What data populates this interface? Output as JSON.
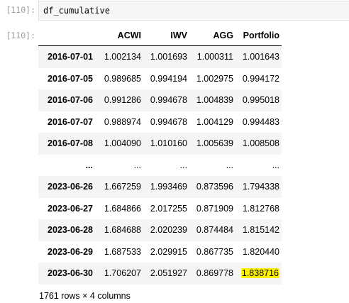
{
  "input_cell": {
    "prompt": "[110]:",
    "code": "df_cumulative"
  },
  "output_cell": {
    "prompt": "[110]:"
  },
  "dataframe": {
    "index_header": "",
    "columns": [
      "ACWI",
      "IWV",
      "AGG",
      "Portfolio"
    ],
    "rows": [
      {
        "index": "2016-07-01",
        "values": [
          "1.002134",
          "1.001693",
          "1.000311",
          "1.001643"
        ]
      },
      {
        "index": "2016-07-05",
        "values": [
          "0.989685",
          "0.994194",
          "1.002975",
          "0.994172"
        ]
      },
      {
        "index": "2016-07-06",
        "values": [
          "0.991286",
          "0.994678",
          "1.004839",
          "0.995018"
        ]
      },
      {
        "index": "2016-07-07",
        "values": [
          "0.988974",
          "0.994678",
          "1.004129",
          "0.994483"
        ]
      },
      {
        "index": "2016-07-08",
        "values": [
          "1.004090",
          "1.010160",
          "1.005639",
          "1.008508"
        ]
      },
      {
        "index": "...",
        "values": [
          "...",
          "...",
          "...",
          "..."
        ]
      },
      {
        "index": "2023-06-26",
        "values": [
          "1.667259",
          "1.993469",
          "0.873596",
          "1.794338"
        ]
      },
      {
        "index": "2023-06-27",
        "values": [
          "1.684866",
          "2.017255",
          "0.871909",
          "1.812768"
        ]
      },
      {
        "index": "2023-06-28",
        "values": [
          "1.684688",
          "2.020239",
          "0.874484",
          "1.815142"
        ]
      },
      {
        "index": "2023-06-29",
        "values": [
          "1.687533",
          "2.029915",
          "0.867735",
          "1.820440"
        ]
      },
      {
        "index": "2023-06-30",
        "values": [
          "1.706207",
          "2.051927",
          "0.869778",
          "1.838716"
        ]
      }
    ],
    "highlight": {
      "row": 10,
      "col": 3,
      "color": "#fff200"
    },
    "summary": "1761 rows × 4 columns"
  }
}
